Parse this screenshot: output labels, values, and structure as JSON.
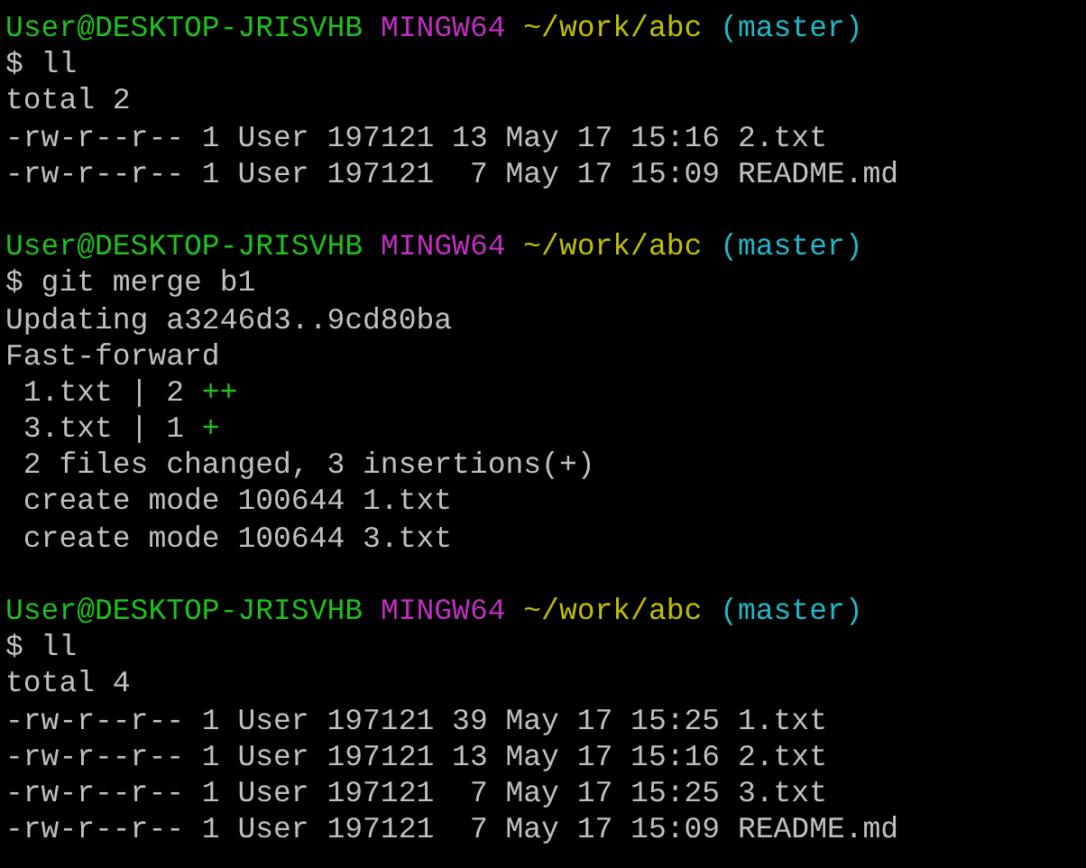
{
  "sessions": [
    {
      "prompt": {
        "user": "User@DESKTOP-JRISVHB",
        "system": "MINGW64",
        "path": "~/work/abc",
        "branch": "(master)"
      },
      "command": "$ ll",
      "output": [
        {
          "text": "total 2",
          "indent": false
        },
        {
          "text": "-rw-r--r-- 1 User 197121 13 May 17 15:16 2.txt",
          "indent": false
        },
        {
          "text": "-rw-r--r-- 1 User 197121  7 May 17 15:09 README.md",
          "indent": false
        }
      ]
    },
    {
      "prompt": {
        "user": "User@DESKTOP-JRISVHB",
        "system": "MINGW64",
        "path": "~/work/abc",
        "branch": "(master)"
      },
      "command": "$ git merge b1",
      "output": [
        {
          "text": "Updating a3246d3..9cd80ba",
          "indent": false
        },
        {
          "text": "Fast-forward",
          "indent": false
        },
        {
          "text": "1.txt | 2",
          "diffstat": "++",
          "indent": true
        },
        {
          "text": "3.txt | 1",
          "diffstat": "+",
          "indent": true
        },
        {
          "text": "2 files changed, 3 insertions(+)",
          "indent": true
        },
        {
          "text": "create mode 100644 1.txt",
          "indent": true
        },
        {
          "text": "create mode 100644 3.txt",
          "indent": true
        }
      ]
    },
    {
      "prompt": {
        "user": "User@DESKTOP-JRISVHB",
        "system": "MINGW64",
        "path": "~/work/abc",
        "branch": "(master)"
      },
      "command": "$ ll",
      "output": [
        {
          "text": "total 4",
          "indent": false
        },
        {
          "text": "-rw-r--r-- 1 User 197121 39 May 17 15:25 1.txt",
          "indent": false
        },
        {
          "text": "-rw-r--r-- 1 User 197121 13 May 17 15:16 2.txt",
          "indent": false
        },
        {
          "text": "-rw-r--r-- 1 User 197121  7 May 17 15:25 3.txt",
          "indent": false
        },
        {
          "text": "-rw-r--r-- 1 User 197121  7 May 17 15:09 README.md",
          "indent": false
        }
      ]
    }
  ]
}
